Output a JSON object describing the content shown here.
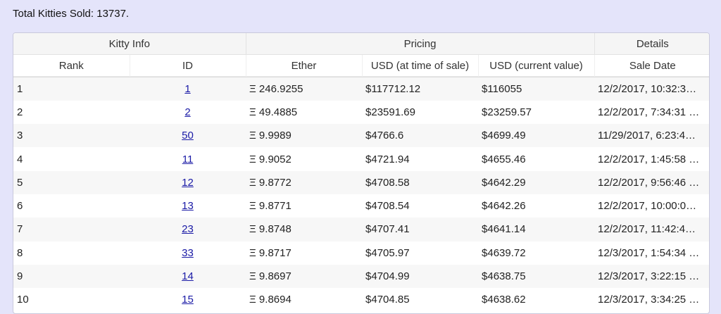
{
  "summary": {
    "total_label": "Total Kitties Sold: 13737."
  },
  "table": {
    "groups": [
      "Kitty Info",
      "Pricing",
      "Details"
    ],
    "columns": [
      "Rank",
      "ID",
      "Ether",
      "USD (at time of sale)",
      "USD (current value)",
      "Sale Date"
    ],
    "rows": [
      {
        "rank": "1",
        "id": "1",
        "ether": "Ξ 246.9255",
        "usd_sale": "$117712.12",
        "usd_current": "$116055",
        "date": "12/2/2017, 10:32:3…"
      },
      {
        "rank": "2",
        "id": "2",
        "ether": "Ξ 49.4885",
        "usd_sale": "$23591.69",
        "usd_current": "$23259.57",
        "date": "12/2/2017, 7:34:31 …"
      },
      {
        "rank": "3",
        "id": "50",
        "ether": "Ξ 9.9989",
        "usd_sale": "$4766.6",
        "usd_current": "$4699.49",
        "date": "11/29/2017, 6:23:4…"
      },
      {
        "rank": "4",
        "id": "11",
        "ether": "Ξ 9.9052",
        "usd_sale": "$4721.94",
        "usd_current": "$4655.46",
        "date": "12/2/2017, 1:45:58 …"
      },
      {
        "rank": "5",
        "id": "12",
        "ether": "Ξ 9.8772",
        "usd_sale": "$4708.58",
        "usd_current": "$4642.29",
        "date": "12/2/2017, 9:56:46 …"
      },
      {
        "rank": "6",
        "id": "13",
        "ether": "Ξ 9.8771",
        "usd_sale": "$4708.54",
        "usd_current": "$4642.26",
        "date": "12/2/2017, 10:00:0…"
      },
      {
        "rank": "7",
        "id": "23",
        "ether": "Ξ 9.8748",
        "usd_sale": "$4707.41",
        "usd_current": "$4641.14",
        "date": "12/2/2017, 11:42:4…"
      },
      {
        "rank": "8",
        "id": "33",
        "ether": "Ξ 9.8717",
        "usd_sale": "$4705.97",
        "usd_current": "$4639.72",
        "date": "12/3/2017, 1:54:34 …"
      },
      {
        "rank": "9",
        "id": "14",
        "ether": "Ξ 9.8697",
        "usd_sale": "$4704.99",
        "usd_current": "$4638.75",
        "date": "12/3/2017, 3:22:15 …"
      },
      {
        "rank": "10",
        "id": "15",
        "ether": "Ξ 9.8694",
        "usd_sale": "$4704.85",
        "usd_current": "$4638.62",
        "date": "12/3/2017, 3:34:25 …"
      }
    ]
  },
  "colors": {
    "page_background": "#e4e4fa",
    "link": "#1a1aa6",
    "header_background": "#f5f5f5",
    "row_stripe": "#f7f7f7"
  }
}
